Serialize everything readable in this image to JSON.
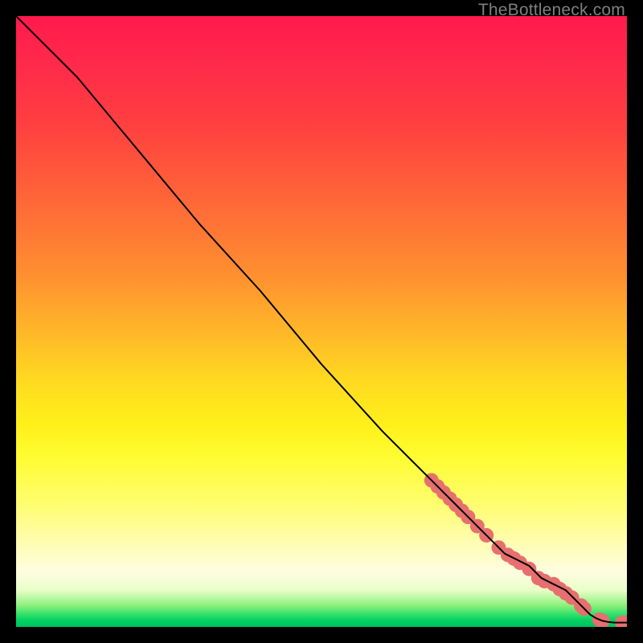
{
  "watermark": "TheBottleneck.com",
  "chart_data": {
    "type": "line",
    "title": "",
    "xlabel": "",
    "ylabel": "",
    "xlim": [
      0,
      100
    ],
    "ylim": [
      0,
      100
    ],
    "grid": false,
    "legend": false,
    "line": {
      "name": "curve",
      "color": "#000000",
      "x": [
        0,
        3,
        6,
        10,
        15,
        20,
        30,
        40,
        50,
        60,
        68,
        70,
        72,
        74,
        76,
        78,
        80,
        82,
        84,
        86,
        88,
        90,
        92,
        94,
        95,
        96,
        97,
        98,
        100
      ],
      "y": [
        100,
        97,
        94,
        90,
        84,
        78,
        66,
        55,
        43,
        32,
        24,
        22,
        20,
        18,
        16,
        14,
        12,
        11,
        10,
        8,
        7,
        6,
        4,
        2,
        1.4,
        1.0,
        0.8,
        0.7,
        0.7
      ]
    },
    "points": {
      "name": "markers",
      "color": "#e76f6f",
      "radius_px": 9,
      "x": [
        68.0,
        69.0,
        70.0,
        71.0,
        72.0,
        73.0,
        74.0,
        75.5,
        77.0,
        79.0,
        80.5,
        81.5,
        82.5,
        84.0,
        85.5,
        86.5,
        88.0,
        89.0,
        90.0,
        91.0,
        92.5,
        93.0,
        95.5,
        96.0,
        99.2,
        100.0
      ],
      "y": [
        24.0,
        23.0,
        22.0,
        21.0,
        20.0,
        19.0,
        18.0,
        16.5,
        15.0,
        13.0,
        11.8,
        11.2,
        10.5,
        9.5,
        8.0,
        7.5,
        7.0,
        6.2,
        5.5,
        4.8,
        3.5,
        3.0,
        1.2,
        1.0,
        0.7,
        0.7
      ]
    }
  }
}
